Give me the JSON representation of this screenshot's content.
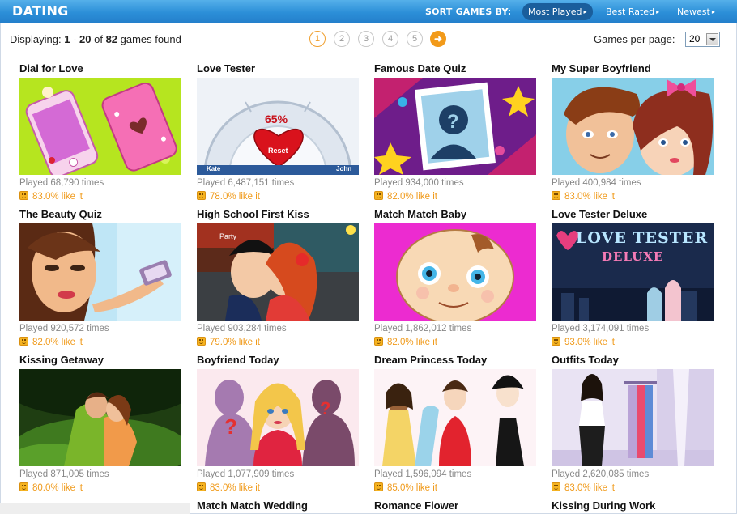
{
  "header": {
    "title": "DATING",
    "sort_label": "SORT GAMES BY:",
    "sort_options": [
      "Most Played",
      "Best Rated",
      "Newest"
    ],
    "sort_arrow": "▸"
  },
  "info": {
    "displaying_label": "Displaying:",
    "range_start": "1",
    "range_sep": " - ",
    "range_end": "20",
    "of_text": " of ",
    "total": "82",
    "suffix": " games found"
  },
  "pagination": {
    "pages": [
      "1",
      "2",
      "3",
      "4",
      "5"
    ],
    "current": "1",
    "next_icon": "➜"
  },
  "per_page": {
    "label": "Games per page:",
    "value": "20"
  },
  "games": [
    {
      "title": "Dial for Love",
      "played": "Played 68,790 times",
      "rating": "83.0% like it",
      "thumb": "phones"
    },
    {
      "title": "Love Tester",
      "played": "Played 6,487,151 times",
      "rating": "78.0% like it",
      "thumb": "tester",
      "thumb_text": {
        "percent": "65%",
        "button": "Reset",
        "left": "Kate",
        "right": "John"
      }
    },
    {
      "title": "Famous Date Quiz",
      "played": "Played 934,000 times",
      "rating": "82.0% like it",
      "thumb": "quiz"
    },
    {
      "title": "My Super Boyfriend",
      "played": "Played 400,984 times",
      "rating": "83.0% like it",
      "thumb": "couple"
    },
    {
      "title": "The Beauty Quiz",
      "played": "Played 920,572 times",
      "rating": "82.0% like it",
      "thumb": "beauty"
    },
    {
      "title": "High School First Kiss",
      "played": "Played 903,284 times",
      "rating": "79.0% like it",
      "thumb": "kiss",
      "thumb_text": {
        "sign": "Party"
      }
    },
    {
      "title": "Match Match Baby",
      "played": "Played 1,862,012 times",
      "rating": "82.0% like it",
      "thumb": "baby"
    },
    {
      "title": "Love Tester Deluxe",
      "played": "Played 3,174,091 times",
      "rating": "93.0% like it",
      "thumb": "deluxe",
      "thumb_text": {
        "line1": "LOVE TESTER",
        "line2": "DELUXE"
      }
    },
    {
      "title": "Kissing Getaway",
      "played": "Played 871,005 times",
      "rating": "80.0% like it",
      "thumb": "getaway"
    },
    {
      "title": "Boyfriend Today",
      "played": "Played 1,077,909 times",
      "rating": "83.0% like it",
      "thumb": "boyfriend"
    },
    {
      "title": "Dream Princess Today",
      "played": "Played 1,596,094 times",
      "rating": "85.0% like it",
      "thumb": "princess"
    },
    {
      "title": "Outfits Today",
      "played": "Played 2,620,085 times",
      "rating": "83.0% like it",
      "thumb": "outfits"
    }
  ],
  "partial_row": [
    "Match Match Wedding",
    "Romance Flower",
    "Kissing During Work"
  ],
  "colors": {
    "header_blue": "#2c8fd8",
    "accent_orange": "#f09a1a",
    "muted_text": "#888888"
  }
}
